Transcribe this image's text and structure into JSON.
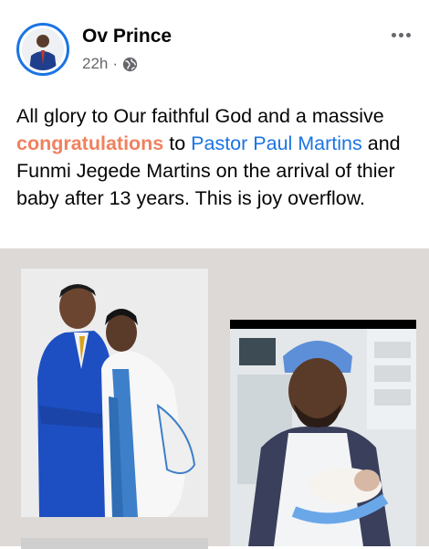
{
  "post": {
    "author": "Ov Prince",
    "time": "22h",
    "separator": "·",
    "privacy_icon": "globe-icon",
    "text_parts": {
      "p1": "All glory to Our faithful God and a massive ",
      "highlight": "congratulations",
      "p2": " to ",
      "link": "Pastor Paul Martins",
      "p3": " and Funmi Jegede Martins on the arrival of thier baby after 13 years. This is joy overflow."
    }
  },
  "colors": {
    "link": "#1b74e4",
    "highlight": "#f0815e",
    "text": "#050505",
    "meta": "#65676b",
    "photo_background": "#dcd9d6"
  },
  "photos": [
    {
      "id": "couple-photo",
      "description_icon": "photo"
    },
    {
      "id": "doctor-baby-photo",
      "description_icon": "photo"
    },
    {
      "id": "third-photo-partial",
      "description_icon": "photo"
    }
  ]
}
